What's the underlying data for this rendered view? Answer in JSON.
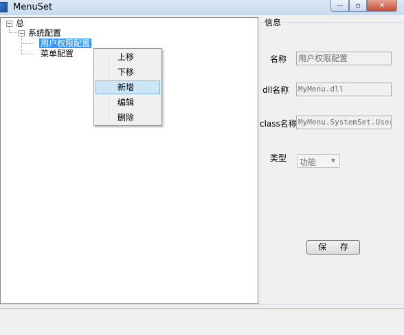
{
  "window": {
    "title": "MenuSet",
    "minimize_glyph": "—",
    "maximize_glyph": "▫",
    "close_glyph": "✕"
  },
  "tree": {
    "root": {
      "label": "总",
      "expander": "−"
    },
    "group": {
      "label": "系统配置",
      "expander": "−"
    },
    "children": [
      {
        "label": "用户权限配置",
        "selected": true
      },
      {
        "label": "菜单配置",
        "selected": false
      }
    ]
  },
  "context_menu": {
    "items": [
      {
        "label": "上移"
      },
      {
        "label": "下移"
      },
      {
        "label": "新增",
        "highlighted": true
      },
      {
        "label": "编辑"
      },
      {
        "label": "删除"
      }
    ]
  },
  "info_panel": {
    "title": "信息",
    "name_label": "名称",
    "name_value": "用户权限配置",
    "dll_label": "dll名称",
    "dll_value": "MyMenu.dll",
    "class_label": "class名称",
    "class_value": "MyMenu.SystemSet.UserS",
    "type_label": "类型",
    "type_value": "功能",
    "save_label": "保 存"
  }
}
